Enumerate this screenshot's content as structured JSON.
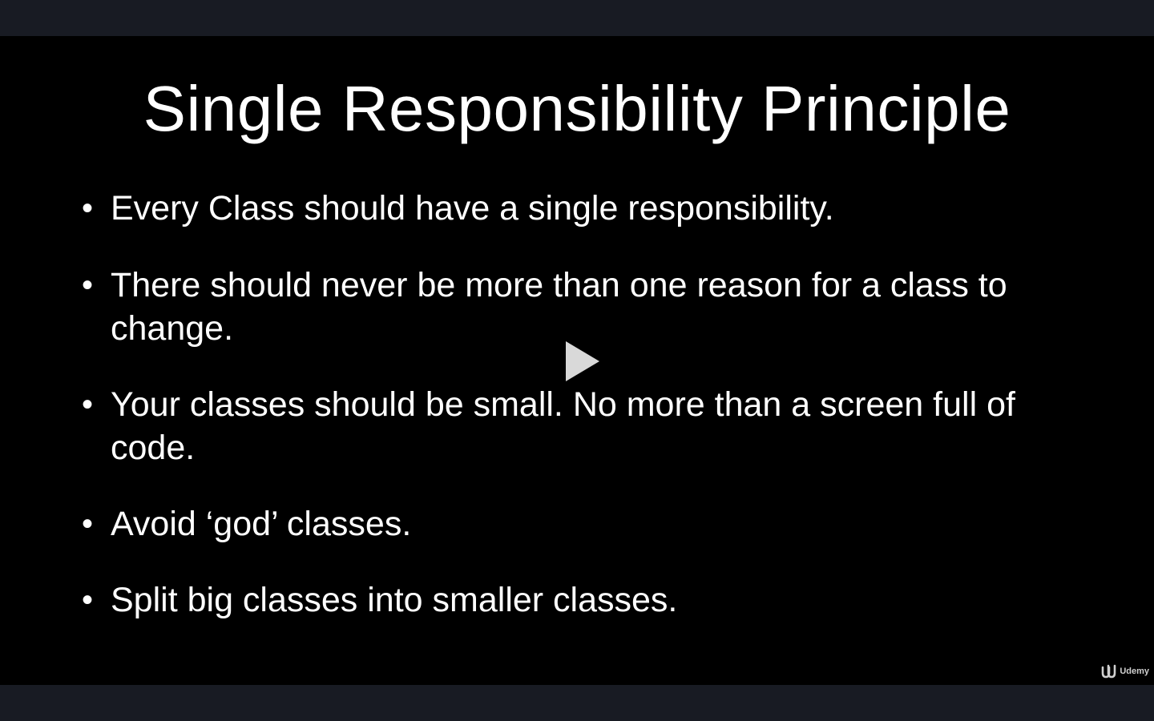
{
  "slide": {
    "title": "Single Responsibility Principle",
    "bullets": [
      "Every Class should have a single responsibility.",
      "There should never be more than one reason for a class to change.",
      "Your classes should be small. No more than a screen full of code.",
      "Avoid ‘god’ classes.",
      "Split big classes into smaller classes."
    ],
    "bullet_marker": "•"
  },
  "player": {
    "play_icon": "play-icon"
  },
  "watermark": {
    "brand": "Udemy",
    "logo_icon": "udemy-logo-icon"
  },
  "colors": {
    "video_background": "#000000",
    "chrome_background": "#181b23",
    "text": "#ffffff",
    "play_icon": "#d9d9d9"
  }
}
